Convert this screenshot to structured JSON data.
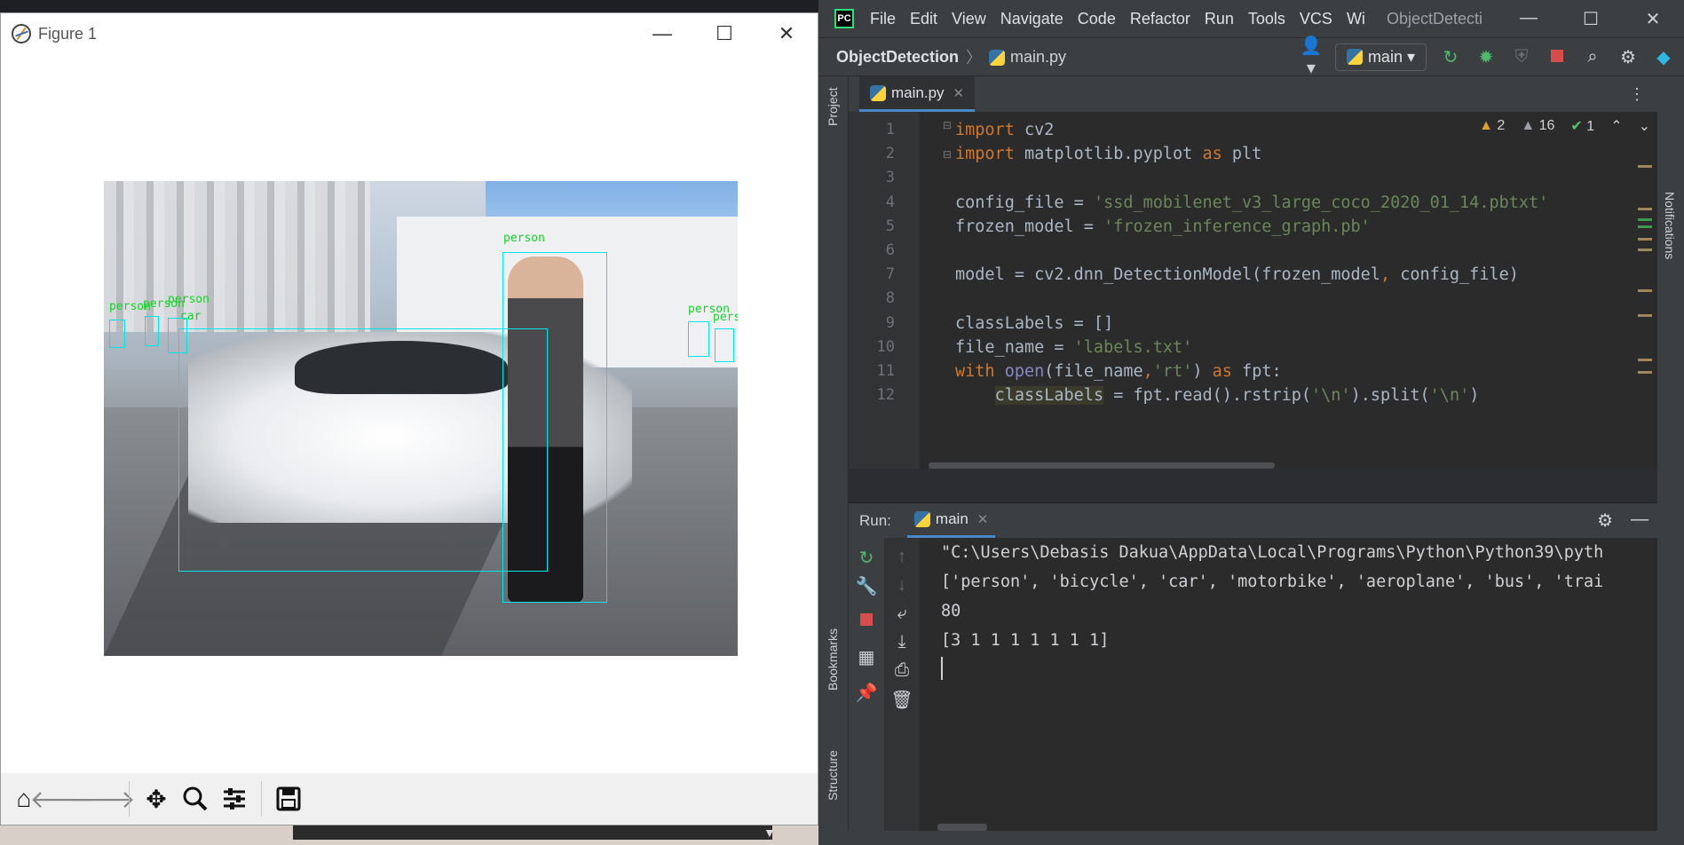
{
  "figure_window": {
    "title": "Figure 1",
    "controls": {
      "minimize": "—",
      "maximize": "☐",
      "close": "✕"
    },
    "detections": [
      {
        "label": "person"
      },
      {
        "label": "person"
      },
      {
        "label": "person"
      },
      {
        "label": "person"
      },
      {
        "label": "person"
      },
      {
        "label": "person"
      },
      {
        "label": "car"
      }
    ],
    "toolbar": [
      "home-icon",
      "back-icon",
      "forward-icon",
      "pan-icon",
      "zoom-icon",
      "configure-subplots-icon",
      "save-icon"
    ]
  },
  "ide": {
    "menu": [
      "File",
      "Edit",
      "View",
      "Navigate",
      "Code",
      "Refactor",
      "Run",
      "Tools",
      "VCS",
      "Wi"
    ],
    "window_title": "ObjectDetecti",
    "controls": {
      "minimize": "—",
      "maximize": "☐",
      "close": "✕"
    },
    "breadcrumb": {
      "project": "ObjectDetection",
      "file": "main.py"
    },
    "run_config": "main",
    "sidebar": {
      "project": "Project",
      "bookmarks": "Bookmarks",
      "structure": "Structure",
      "notifications": "Notifications"
    },
    "editor": {
      "tab": "main.py",
      "inspections": {
        "warnings": "2",
        "weak_warnings": "16",
        "typos": "1"
      },
      "lines": [
        {
          "n": "1",
          "parts": [
            [
              "kw",
              "import"
            ],
            [
              "plain",
              " cv2"
            ]
          ]
        },
        {
          "n": "2",
          "parts": [
            [
              "kw",
              "import"
            ],
            [
              "plain",
              " matplotlib.pyplot "
            ],
            [
              "kw",
              "as"
            ],
            [
              "plain",
              " plt"
            ]
          ]
        },
        {
          "n": "3",
          "parts": []
        },
        {
          "n": "4",
          "parts": [
            [
              "plain",
              "config_file = "
            ],
            [
              "str",
              "'ssd_mobilenet_v3_large_coco_2020_01_14.pbtxt'"
            ]
          ]
        },
        {
          "n": "5",
          "parts": [
            [
              "plain",
              "frozen_model = "
            ],
            [
              "str",
              "'frozen_inference_graph.pb'"
            ]
          ]
        },
        {
          "n": "6",
          "parts": []
        },
        {
          "n": "7",
          "parts": [
            [
              "plain",
              "model = cv2.dnn_DetectionModel(frozen_model"
            ],
            [
              "kw",
              ","
            ],
            [
              "plain",
              " config_file)"
            ]
          ]
        },
        {
          "n": "8",
          "parts": []
        },
        {
          "n": "9",
          "parts": [
            [
              "plain",
              "classLabels = []"
            ]
          ]
        },
        {
          "n": "10",
          "parts": [
            [
              "plain",
              "file_name = "
            ],
            [
              "str",
              "'labels.txt'"
            ]
          ]
        },
        {
          "n": "11",
          "parts": [
            [
              "kw",
              "with "
            ],
            [
              "fn",
              "open"
            ],
            [
              "plain",
              "(file_name"
            ],
            [
              "kw",
              ","
            ],
            [
              "str",
              "'rt'"
            ],
            [
              "plain",
              ") "
            ],
            [
              "kw",
              "as"
            ],
            [
              "plain",
              " fpt:"
            ]
          ]
        },
        {
          "n": "12",
          "parts": [
            [
              "plain",
              "    "
            ],
            [
              "hl",
              "classLabels"
            ],
            [
              "plain",
              " = fpt.read().rstrip("
            ],
            [
              "str",
              "'\\n'"
            ],
            [
              "plain",
              ").split("
            ],
            [
              "str",
              "'\\n'"
            ],
            [
              "plain",
              ")"
            ]
          ]
        }
      ]
    },
    "run": {
      "label": "Run:",
      "tab": "main",
      "output": [
        "\"C:\\Users\\Debasis Dakua\\AppData\\Local\\Programs\\Python\\Python39\\pyth",
        "['person', 'bicycle', 'car', 'motorbike', 'aeroplane', 'bus', 'trai",
        "80",
        "[3 1 1 1 1 1 1 1]"
      ]
    }
  },
  "colors": {
    "bbox": "#00e5e5",
    "label": "#16d12a",
    "keyword": "#cc7832",
    "string": "#6a8759"
  }
}
